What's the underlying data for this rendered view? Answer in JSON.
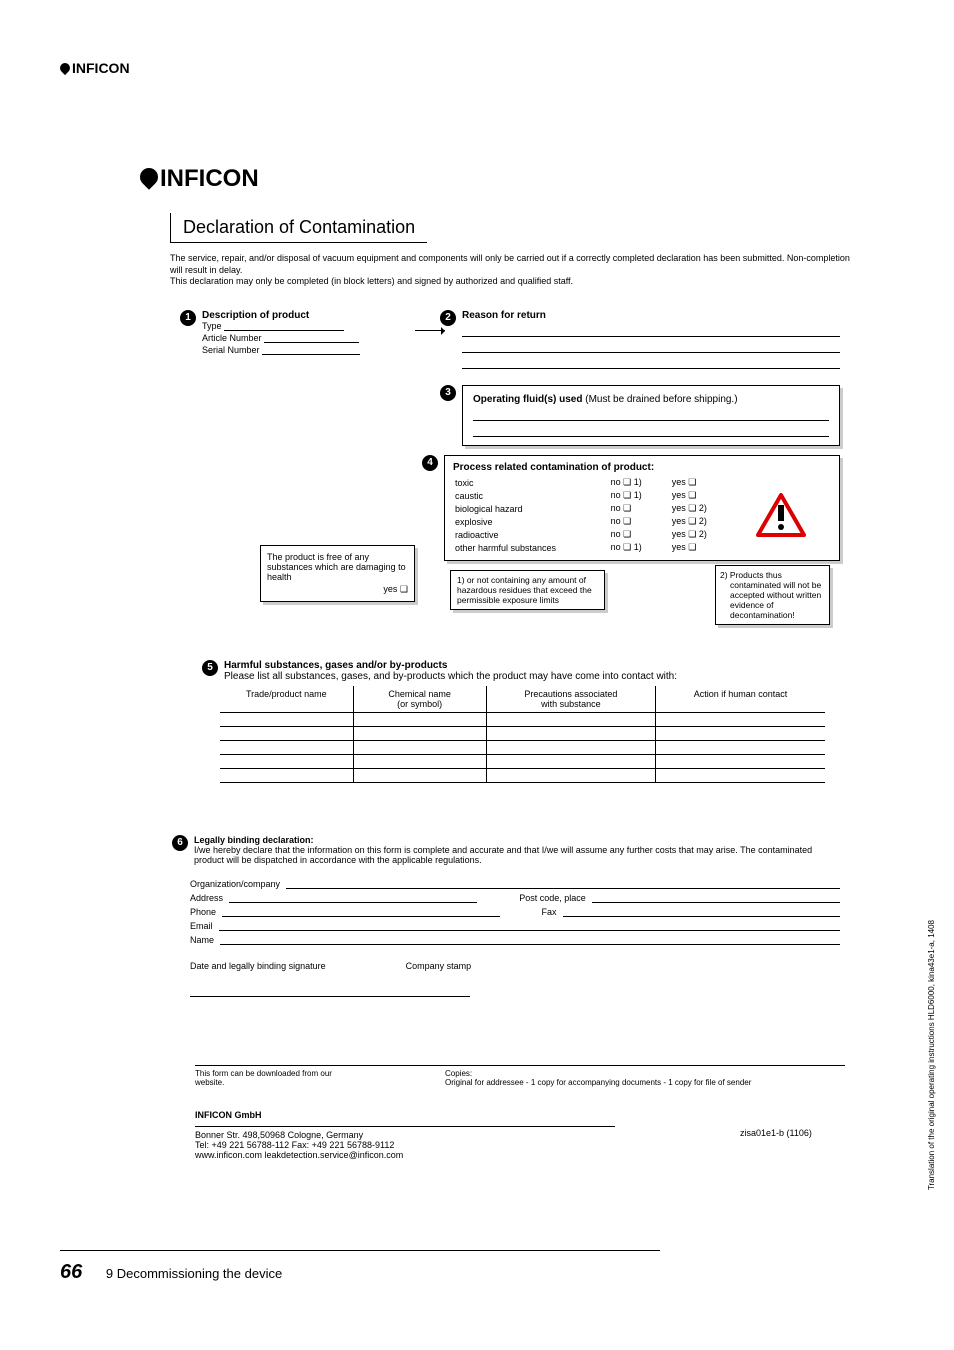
{
  "brand_header": "INFICON",
  "form_logo": "INFICON",
  "title": "Declaration of Contamination",
  "intro_l1": "The service, repair, and/or disposal of vacuum equipment and components will only be carried out if a correctly completed declaration has been submitted. Non-completion will result in delay.",
  "intro_l2": "This declaration may only be completed (in block letters) and signed by authorized and qualified staff.",
  "sec1": {
    "num": "1",
    "heading": "Description of product",
    "type_lbl": "Type",
    "article_lbl": "Article Number",
    "serial_lbl": "Serial Number"
  },
  "sec2": {
    "num": "2",
    "heading": "Reason for return"
  },
  "sec3": {
    "num": "3",
    "heading": "Operating fluid(s) used",
    "note": "(Must be drained before shipping.)"
  },
  "sec4": {
    "num": "4",
    "heading": "Process related contamination of product:",
    "rows": [
      {
        "label": "toxic",
        "no": "no ❏ 1)",
        "yes": "yes ❏"
      },
      {
        "label": "caustic",
        "no": "no ❏ 1)",
        "yes": "yes ❏"
      },
      {
        "label": "biological hazard",
        "no": "no ❏",
        "yes": "yes ❏ 2)"
      },
      {
        "label": "explosive",
        "no": "no ❏",
        "yes": "yes ❏ 2)"
      },
      {
        "label": "radioactive",
        "no": "no ❏",
        "yes": "yes ❏ 2)"
      },
      {
        "label": "other harmful substances",
        "no": "no ❏ 1)",
        "yes": "yes ❏"
      }
    ],
    "note1": "1)  or not containing any amount of hazardous residues that exceed the permissible exposure limits",
    "note2": "2)  Products thus contaminated will not be accepted without written evidence of decontamination!"
  },
  "free_box": {
    "text": "The product is free of any substances which are damaging to health",
    "yes": "yes ❏"
  },
  "sec5": {
    "num": "5",
    "heading": "Harmful substances, gases and/or by-products",
    "sub": "Please list all substances, gases, and by-products which the product may have come into contact with:",
    "cols": [
      "Trade/product name",
      "Chemical name\n(or symbol)",
      "Precautions associated\nwith substance",
      "Action if human contact"
    ]
  },
  "sec6": {
    "num": "6",
    "heading": "Legally binding declaration:",
    "text": "I/we hereby declare that the information on this form is complete and accurate and that I/we will assume any further costs that may arise. The contaminated product will be dispatched in accordance with the applicable regulations.",
    "org": "Organization/company",
    "addr": "Address",
    "post": "Post code, place",
    "phone": "Phone",
    "fax": "Fax",
    "email": "Email",
    "name": "Name",
    "sig": "Date and legally binding signature",
    "stamp": "Company stamp"
  },
  "footer_dl": "This form can be downloaded from our website.",
  "footer_copies": "Copies:\nOriginal for addressee - 1 copy for accompanying documents - 1 copy for file of sender",
  "company": {
    "name": "INFICON GmbH",
    "addr": "Bonner Str. 498,50968 Cologne, Germany",
    "tel": "Tel: +49 221 56788-112   Fax: +49 221 56788-9112",
    "web": "www.inficon.com   leakdetection.service@inficon.com"
  },
  "doc_code": "zisa01e1-b (1106)",
  "page_num": "66",
  "chapter": "9  Decommissioning the device",
  "side_text": "Translation of the original operating instructions HLD6000, kina43e1-a, 1408"
}
